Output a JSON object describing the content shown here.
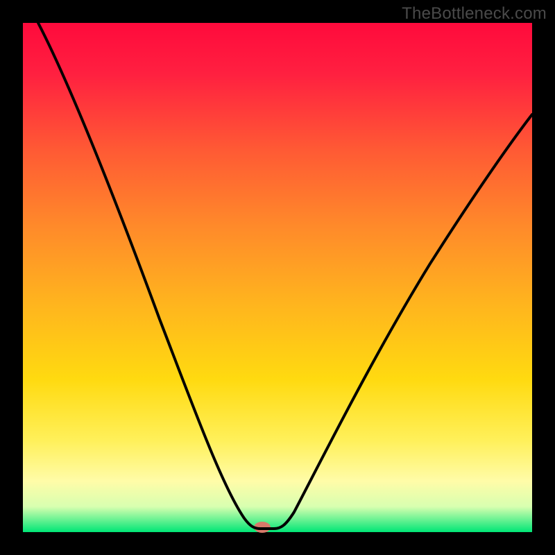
{
  "attribution": "TheBottleneck.com",
  "chart_data": {
    "type": "line",
    "title": "",
    "xlabel": "",
    "ylabel": "",
    "xlim": [
      0,
      100
    ],
    "ylim": [
      0,
      100
    ],
    "x": [
      0,
      8,
      16,
      24,
      32,
      40,
      43,
      45,
      48,
      52,
      60,
      70,
      80,
      90,
      100
    ],
    "values": [
      100,
      92,
      79,
      62,
      41,
      15,
      4,
      0,
      0,
      5,
      23,
      41,
      54,
      64,
      72
    ],
    "note": "V-shaped bottleneck curve. Y values are approximate percentage of plot height from bottom (green band) to top (red). Minimum near x≈45-48.",
    "background_gradient": [
      "#ff1744",
      "#ff5722",
      "#ff9800",
      "#ffc107",
      "#ffeb3b",
      "#fff176",
      "#00e676"
    ],
    "marker": {
      "x": 47,
      "color": "#d87a6a"
    }
  }
}
